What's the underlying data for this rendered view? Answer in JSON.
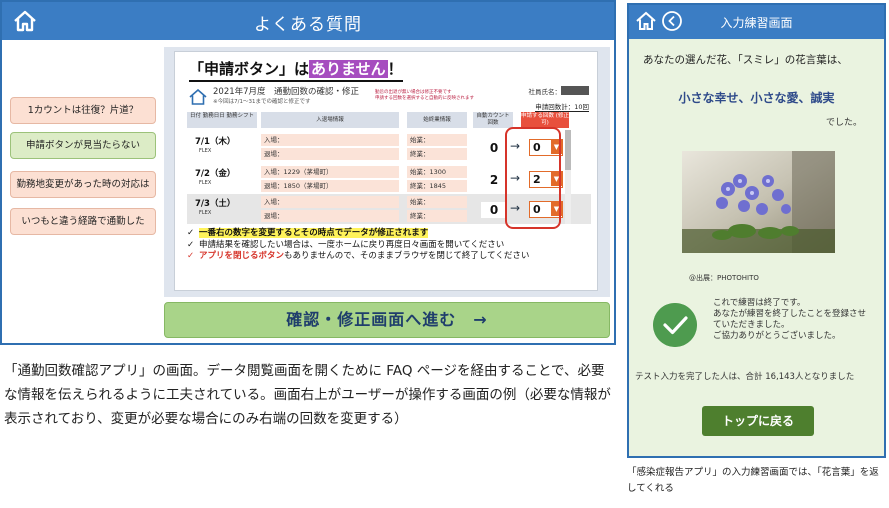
{
  "colors": {
    "header_blue": "#3b7dc4",
    "button_pink": "#fce0d3",
    "button_green": "#dcecc6",
    "proceed_green": "#a9d489",
    "accent_red": "#d6342a",
    "accent_orange": "#e26b2a",
    "highlight_purple": "#a64dbf",
    "phone_bg": "#eaf3e0",
    "top_button": "#4e7f2e"
  },
  "faq": {
    "title": "よくある質問",
    "home_icon": "home-icon",
    "buttons": [
      {
        "label": "1カウントは往復？片道？",
        "active": false
      },
      {
        "label": "申請ボタンが見当たらない",
        "active": true
      },
      {
        "label": "勤務地変更があった時の対応は",
        "active": false
      },
      {
        "label": "いつもと違う経路で通勤した",
        "active": false
      }
    ],
    "heading_pre": "「申請ボタン」は",
    "heading_hl": "ありません",
    "heading_post": "！",
    "mini": {
      "title": "2021年7月度　通勤回数の確認・修正",
      "sub": "※今回は7/1～31までの確認と修正です",
      "note_line1": "勤怠の出退が無い場合は修正不要です",
      "note_line2": "申請する回数を選択すると自動的に反映されます",
      "employee_label": "社員氏名：",
      "count_label": "申請回数計：10回",
      "headers": [
        "日付\n勤務日日 勤務シフト",
        "入退場情報",
        "始終業情報",
        "自動カウント\n回数",
        "申請する回数\n(修正可)"
      ],
      "rows": [
        {
          "date": "7/1（木）",
          "shift": "FLEX",
          "in": "入場：",
          "out": "退場：",
          "start": "始業：",
          "end": "終業：",
          "count": "0",
          "select": "0"
        },
        {
          "date": "7/2（金）",
          "shift": "FLEX",
          "in": "入場：1229（茅場町）",
          "out": "退場：1850（茅場町）",
          "start": "始業：1300",
          "end": "終業：1845",
          "count": "2",
          "select": "2"
        },
        {
          "date": "7/3（土）",
          "shift": "FLEX",
          "in": "入場：",
          "out": "退場：",
          "start": "始業：",
          "end": "終業：",
          "count": "0",
          "select": "0"
        }
      ],
      "notes": [
        {
          "check": "✓",
          "text": "一番右の数字を変更するとその時点でデータが修正されます",
          "style": "yellow"
        },
        {
          "check": "✓",
          "text": "申請結果を確認したい場合は、一度ホームに戻り再度日々画面を開いてください",
          "style": "plain"
        },
        {
          "check": "✓",
          "text_red": "アプリを閉じるボタン",
          "text_rest": "もありませんので、そのままブラウザを閉じて終了してください",
          "style": "red"
        }
      ]
    },
    "proceed_label": "確認・修正画面へ進む　→"
  },
  "caption_left": "「通勤回数確認アプリ」の画面。データ閲覧画面を開くために FAQ ページを経由することで、必要な情報を伝えられるように工夫されている。画面右上がユーザーが操作する画面の例（必要な情報が表示されており、変更が必要な場合にのみ右端の回数を変更する）",
  "phone": {
    "title": "入力練習画面",
    "home_icon": "home-icon",
    "back_icon": "back-circle-icon",
    "intro": "あなたの選んだ花、「スミレ」の花言葉は、",
    "flower_words": "小さな幸せ、小さな愛、誠実",
    "desu": "でした。",
    "photo_credit": "@出展：PHOTOHITO",
    "done_line1": "これで練習は終了です。",
    "done_line2": "あなたが練習を終了したことを登録させていただきました。",
    "done_line3": "ご協力ありがとうございました。",
    "count_text": "テスト入力を完了した人は、合計 16,143人となりました",
    "top_button": "トップに戻る",
    "check_icon": "check-icon"
  },
  "caption_right": "「感染症報告アプリ」の入力練習画面では、「花言葉」を返してくれる"
}
